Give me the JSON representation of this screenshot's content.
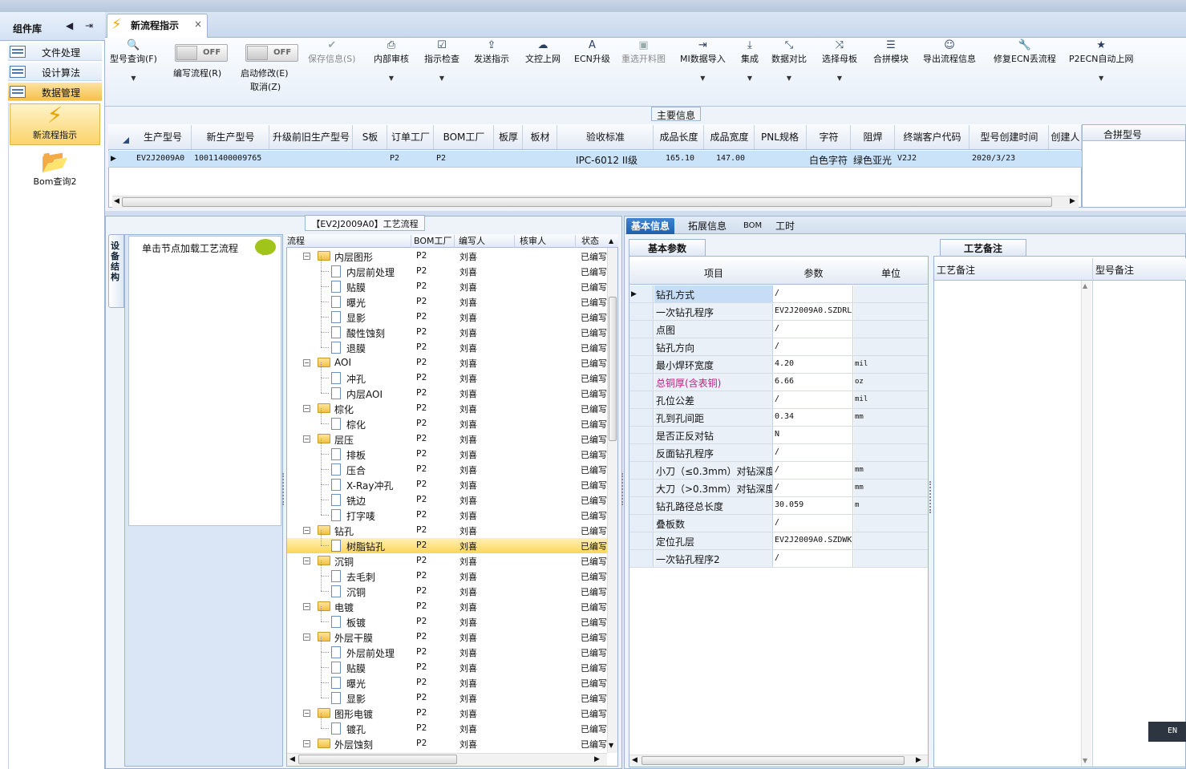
{
  "window": {
    "tab_title": "新流程指示",
    "close": "×"
  },
  "left_panel": {
    "title": "组件库",
    "items": [
      {
        "label": "文件处理",
        "selected": false
      },
      {
        "label": "设计算法",
        "selected": false
      },
      {
        "label": "数据管理",
        "selected": true
      }
    ],
    "buttons": [
      {
        "label": "新流程指示"
      },
      {
        "label": "Bom查询2"
      }
    ]
  },
  "toolbar": {
    "items": [
      {
        "label": "型号查询(F)",
        "icon": "search-icon",
        "glyph": "🔍",
        "dropdown": true,
        "enabled": true
      },
      {
        "label": "保存信息(S)",
        "icon": "check-icon",
        "glyph": "✔",
        "dropdown": false,
        "enabled": false
      },
      {
        "label": "内部审核",
        "icon": "printer-icon",
        "glyph": "⎙",
        "dropdown": true,
        "enabled": true
      },
      {
        "label": "指示检查",
        "icon": "checkbox-icon",
        "glyph": "☑",
        "dropdown": true,
        "enabled": true
      },
      {
        "label": "发送指示",
        "icon": "upload-icon",
        "glyph": "⇪",
        "dropdown": false,
        "enabled": true
      },
      {
        "label": "文控上网",
        "icon": "cloud-upload-icon",
        "glyph": "☁",
        "dropdown": false,
        "enabled": true
      },
      {
        "label": "ECN升级",
        "icon": "font-icon",
        "glyph": "A",
        "dropdown": false,
        "enabled": true
      },
      {
        "label": "重选开料图",
        "icon": "image-icon",
        "glyph": "▣",
        "dropdown": false,
        "enabled": false
      },
      {
        "label": "MI数据导入",
        "icon": "sign-in-icon",
        "glyph": "⇥",
        "dropdown": true,
        "enabled": true
      },
      {
        "label": "集成",
        "icon": "download-icon",
        "glyph": "⤓",
        "dropdown": true,
        "enabled": true
      },
      {
        "label": "数据对比",
        "icon": "compress-icon",
        "glyph": "⤡",
        "dropdown": true,
        "enabled": true
      },
      {
        "label": "选择母板",
        "icon": "shuffle-icon",
        "glyph": "⤨",
        "dropdown": true,
        "enabled": true
      },
      {
        "label": "合拼模块",
        "icon": "list-icon",
        "glyph": "☰",
        "dropdown": false,
        "enabled": true
      },
      {
        "label": "导出流程信息",
        "icon": "smile-icon",
        "glyph": "☺",
        "dropdown": false,
        "enabled": true
      },
      {
        "label": "修复ECN丢流程",
        "icon": "wrench-icon",
        "glyph": "🔧",
        "dropdown": false,
        "enabled": true
      },
      {
        "label": "P2ECN自动上网",
        "icon": "star-icon",
        "glyph": "★",
        "dropdown": true,
        "enabled": true
      }
    ],
    "toggles": [
      {
        "label": "编写流程(R)",
        "state": "OFF"
      },
      {
        "label": "启动修改(E)",
        "label2": "取消(Z)",
        "state": "OFF"
      }
    ]
  },
  "main_info": {
    "section_title": "主要信息",
    "columns": [
      "生产型号",
      "新生产型号",
      "升级前旧生产型号",
      "S板",
      "订单工厂",
      "BOM工厂",
      "板厚",
      "板材",
      "验收标准",
      "成品长度",
      "成品宽度",
      "PNL规格",
      "字符",
      "阻焊",
      "终端客户代码",
      "型号创建时间",
      "创建人"
    ],
    "row": [
      "EV2J2009A0",
      "10011400009765",
      "",
      "",
      "P2",
      "P2",
      "",
      "",
      "IPC-6012 II级",
      "165.10",
      "147.00",
      "",
      "白色字符",
      "绿色亚光",
      "V2J2",
      "2020/3/23",
      ""
    ],
    "right_header": "合拼型号"
  },
  "process": {
    "title": "【EV2J2009A0】工艺流程",
    "side_tab": "设备结构",
    "device_hint": "单击节点加载工艺流程",
    "columns": [
      "流程",
      "BOM工厂",
      "编写人",
      "核审人",
      "状态"
    ],
    "rows": [
      {
        "name": "内层图形",
        "level": 0,
        "bom": "P2",
        "writer": "刘喜",
        "status": "已编写"
      },
      {
        "name": "内层前处理",
        "level": 1,
        "bom": "P2",
        "writer": "刘喜",
        "status": "已编写"
      },
      {
        "name": "贴膜",
        "level": 1,
        "bom": "P2",
        "writer": "刘喜",
        "status": "已编写"
      },
      {
        "name": "曝光",
        "level": 1,
        "bom": "P2",
        "writer": "刘喜",
        "status": "已编写"
      },
      {
        "name": "显影",
        "level": 1,
        "bom": "P2",
        "writer": "刘喜",
        "status": "已编写"
      },
      {
        "name": "酸性蚀刻",
        "level": 1,
        "bom": "P2",
        "writer": "刘喜",
        "status": "已编写"
      },
      {
        "name": "退膜",
        "level": 1,
        "bom": "P2",
        "writer": "刘喜",
        "status": "已编写"
      },
      {
        "name": "AOI",
        "level": 0,
        "bom": "P2",
        "writer": "刘喜",
        "status": "已编写"
      },
      {
        "name": "冲孔",
        "level": 1,
        "bom": "P2",
        "writer": "刘喜",
        "status": "已编写"
      },
      {
        "name": "内层AOI",
        "level": 1,
        "bom": "P2",
        "writer": "刘喜",
        "status": "已编写"
      },
      {
        "name": "棕化",
        "level": 0,
        "bom": "P2",
        "writer": "刘喜",
        "status": "已编写"
      },
      {
        "name": "棕化",
        "level": 1,
        "bom": "P2",
        "writer": "刘喜",
        "status": "已编写"
      },
      {
        "name": "层压",
        "level": 0,
        "bom": "P2",
        "writer": "刘喜",
        "status": "已编写"
      },
      {
        "name": "排板",
        "level": 1,
        "bom": "P2",
        "writer": "刘喜",
        "status": "已编写"
      },
      {
        "name": "压合",
        "level": 1,
        "bom": "P2",
        "writer": "刘喜",
        "status": "已编写"
      },
      {
        "name": "X-Ray冲孔",
        "level": 1,
        "bom": "P2",
        "writer": "刘喜",
        "status": "已编写"
      },
      {
        "name": "铣边",
        "level": 1,
        "bom": "P2",
        "writer": "刘喜",
        "status": "已编写"
      },
      {
        "name": "打字唛",
        "level": 1,
        "bom": "P2",
        "writer": "刘喜",
        "status": "已编写"
      },
      {
        "name": "钻孔",
        "level": 0,
        "bom": "P2",
        "writer": "刘喜",
        "status": "已编写"
      },
      {
        "name": "树脂钻孔",
        "level": 1,
        "bom": "P2",
        "writer": "刘喜",
        "status": "已编写",
        "selected": true
      },
      {
        "name": "沉铜",
        "level": 0,
        "bom": "P2",
        "writer": "刘喜",
        "status": "已编写"
      },
      {
        "name": "去毛刺",
        "level": 1,
        "bom": "P2",
        "writer": "刘喜",
        "status": "已编写"
      },
      {
        "name": "沉铜",
        "level": 1,
        "bom": "P2",
        "writer": "刘喜",
        "status": "已编写"
      },
      {
        "name": "电镀",
        "level": 0,
        "bom": "P2",
        "writer": "刘喜",
        "status": "已编写"
      },
      {
        "name": "板镀",
        "level": 1,
        "bom": "P2",
        "writer": "刘喜",
        "status": "已编写"
      },
      {
        "name": "外层干膜",
        "level": 0,
        "bom": "P2",
        "writer": "刘喜",
        "status": "已编写"
      },
      {
        "name": "外层前处理",
        "level": 1,
        "bom": "P2",
        "writer": "刘喜",
        "status": "已编写"
      },
      {
        "name": "贴膜",
        "level": 1,
        "bom": "P2",
        "writer": "刘喜",
        "status": "已编写"
      },
      {
        "name": "曝光",
        "level": 1,
        "bom": "P2",
        "writer": "刘喜",
        "status": "已编写"
      },
      {
        "name": "显影",
        "level": 1,
        "bom": "P2",
        "writer": "刘喜",
        "status": "已编写"
      },
      {
        "name": "图形电镀",
        "level": 0,
        "bom": "P2",
        "writer": "刘喜",
        "status": "已编写"
      },
      {
        "name": "镀孔",
        "level": 1,
        "bom": "P2",
        "writer": "刘喜",
        "status": "已编写"
      },
      {
        "name": "外层蚀刻",
        "level": 0,
        "bom": "P2",
        "writer": "刘喜",
        "status": "已编写"
      }
    ]
  },
  "detail_tabs": [
    "基本信息",
    "拓展信息",
    "BOM",
    "工时"
  ],
  "basic_params": {
    "tab": "基本参数",
    "columns": [
      "项目",
      "参数",
      "单位"
    ],
    "rows": [
      {
        "k": "钻孔方式",
        "v": "/",
        "u": ""
      },
      {
        "k": "一次钻孔程序",
        "v": "EV2J2009A0.SZDRL",
        "u": ""
      },
      {
        "k": "点图",
        "v": "/",
        "u": ""
      },
      {
        "k": "钻孔方向",
        "v": "/",
        "u": ""
      },
      {
        "k": "最小焊环宽度",
        "v": "4.20",
        "u": "mil"
      },
      {
        "k": "总铜厚(含表铜)",
        "v": "6.66",
        "u": "oz",
        "highlight": true
      },
      {
        "k": "孔位公差",
        "v": "/",
        "u": "mil"
      },
      {
        "k": "孔到孔间距",
        "v": "0.34",
        "u": "mm"
      },
      {
        "k": "是否正反对钻",
        "v": "N",
        "u": ""
      },
      {
        "k": "反面钻孔程序",
        "v": "/",
        "u": ""
      },
      {
        "k": "小刀（≤0.3mm）对钻深度",
        "v": "/",
        "u": "mm"
      },
      {
        "k": "大刀（>0.3mm）对钻深度",
        "v": "/",
        "u": "mm"
      },
      {
        "k": "钻孔路径总长度",
        "v": "30.059",
        "u": "m"
      },
      {
        "k": "叠板数",
        "v": "/",
        "u": ""
      },
      {
        "k": "定位孔层",
        "v": "EV2J2009A0.SZDWK",
        "u": ""
      },
      {
        "k": "一次钻孔程序2",
        "v": "/",
        "u": ""
      }
    ]
  },
  "process_notes": {
    "tab": "工艺备注",
    "columns": [
      "工艺备注",
      "型号备注"
    ]
  },
  "ime": {
    "label": "EN"
  }
}
